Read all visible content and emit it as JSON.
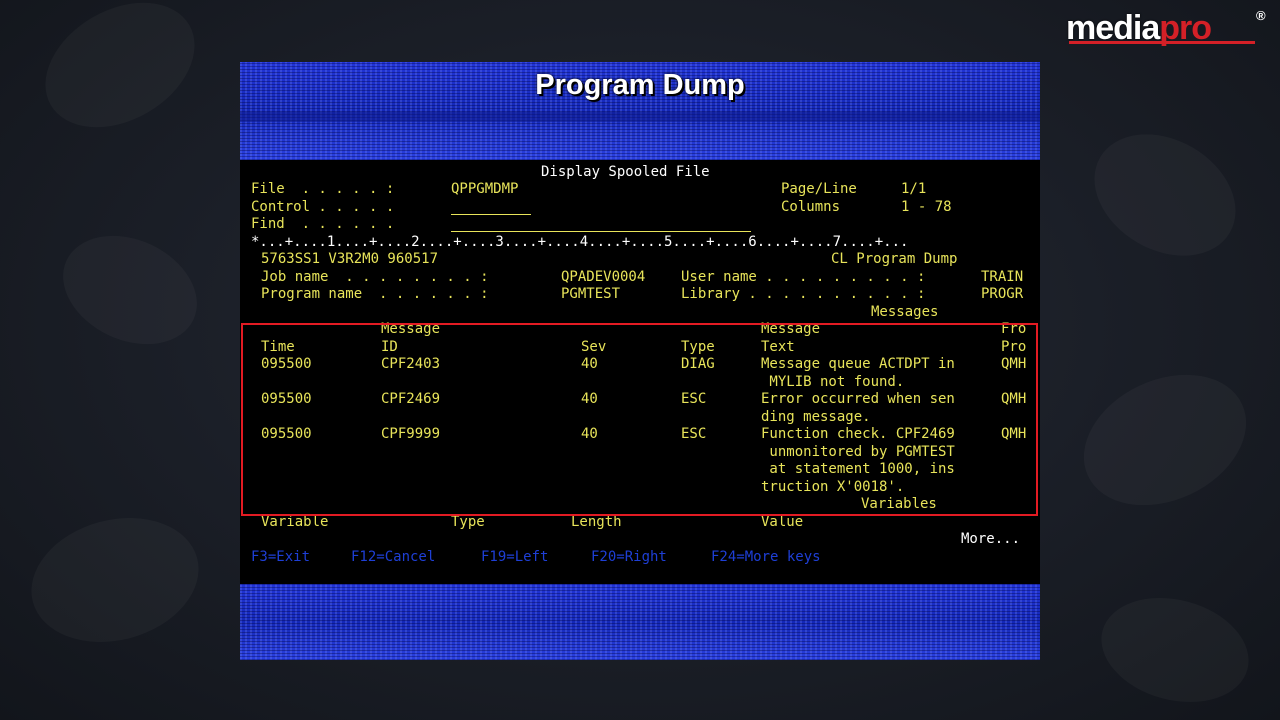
{
  "logo": {
    "media": "media",
    "pro": "pro",
    "reg": "®"
  },
  "slide": {
    "title": "Program Dump"
  },
  "screen": {
    "header": "Display Spooled File",
    "file_label": "File  . . . . . :",
    "file_value": "QPPGMDMP",
    "control_label": "Control . . . . .",
    "find_label": "Find  . . . . . .",
    "page_line_label": "Page/Line",
    "page_line_value": "1/1",
    "columns_label": "Columns",
    "columns_value": "1 - 78",
    "ruler": "*...+....1....+....2....+....3....+....4....+....5....+....6....+....7....+...",
    "system_id": "5763SS1 V3R2M0 960517",
    "report_title": "CL Program Dump",
    "job_name_label": "Job name  . . . . . . . . :",
    "job_name_value": "QPADEV0004",
    "user_name_label": "User name . . . . . . . . . :",
    "user_name_value": "TRAIN",
    "program_name_label": "Program name  . . . . . . :",
    "program_name_value": "PGMTEST",
    "library_label": "Library . . . . . . . . . . :",
    "library_value": "PROGR",
    "messages_heading": "Messages",
    "col_message_top": "Message",
    "col_time": "Time",
    "col_id": "ID",
    "col_sev": "Sev",
    "col_type": "Type",
    "col_message_top2": "Message",
    "col_text": "Text",
    "col_from_top": "Fro",
    "col_from": "Pro",
    "messages": [
      {
        "time": "095500",
        "id": "CPF2403",
        "sev": "40",
        "type": "DIAG",
        "text": "Message queue ACTDPT in",
        "from": "QMH",
        "cont": [
          " MYLIB not found."
        ]
      },
      {
        "time": "095500",
        "id": "CPF2469",
        "sev": "40",
        "type": "ESC",
        "text": "Error occurred when sen",
        "from": "QMH",
        "cont": [
          "ding message."
        ]
      },
      {
        "time": "095500",
        "id": "CPF9999",
        "sev": "40",
        "type": "ESC",
        "text": "Function check. CPF2469",
        "from": "QMH",
        "cont": [
          " unmonitored by PGMTEST",
          " at statement 1000, ins",
          "truction X'0018'."
        ]
      }
    ],
    "variables_heading": "Variables",
    "var_col_variable": "Variable",
    "var_col_type": "Type",
    "var_col_length": "Length",
    "var_col_value": "Value",
    "more": "More...",
    "fkeys": [
      "F3=Exit",
      "F12=Cancel",
      "F19=Left",
      "F20=Right",
      "F24=More keys"
    ]
  },
  "colors": {
    "terminal_text": "#e8e45a",
    "terminal_bg": "#000000",
    "fkey_blue": "#1e3fd6",
    "highlight_border": "#e31b23",
    "slide_blue": "#1a2fd0",
    "logo_red": "#d42027"
  }
}
